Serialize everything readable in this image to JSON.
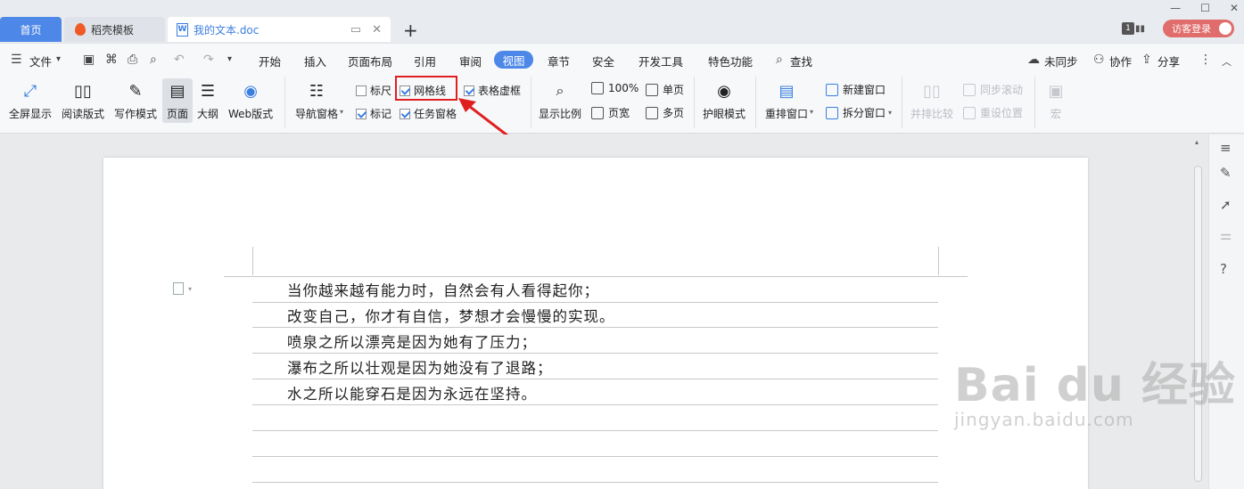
{
  "tabs": {
    "home": "首页",
    "daoke": "稻壳模板",
    "doc": "我的文本.doc"
  },
  "titlebar": {
    "badge": "1",
    "login": "访客登录"
  },
  "menu": {
    "file": "文件",
    "items": [
      "开始",
      "插入",
      "页面布局",
      "引用",
      "审阅",
      "视图",
      "章节",
      "安全",
      "开发工具",
      "特色功能"
    ],
    "active": "视图",
    "search": "查找",
    "sync": "未同步",
    "collab": "协作",
    "share": "分享"
  },
  "ribbon": {
    "fullscreen": "全屏显示",
    "reading": "阅读版式",
    "writing": "写作模式",
    "page": "页面",
    "outline": "大纲",
    "web": "Web版式",
    "nav_pane": "导航窗格",
    "ruler": "标尺",
    "gridlines": "网格线",
    "table_gridlines": "表格虚框",
    "marks": "标记",
    "task_pane": "任务窗格",
    "zoom": "显示比例",
    "zoom100": "100%",
    "single_page": "单页",
    "page_width": "页宽",
    "multi_page": "多页",
    "eye_mode": "护眼模式",
    "rearrange": "重排窗口",
    "new_window": "新建窗口",
    "split_window": "拆分窗口",
    "side_by_side": "并排比较",
    "sync_scroll": "同步滚动",
    "reset_pos": "重设位置",
    "macro": "宏"
  },
  "document": {
    "lines": [
      "当你越来越有能力时，自然会有人看得起你；",
      "改变自己，你才有自信，梦想才会慢慢的实现。",
      "喷泉之所以漂亮是因为她有了压力；",
      "瀑布之所以壮观是因为她没有了退路；",
      "水之所以能穿石是因为永远在坚持。"
    ]
  },
  "watermark": {
    "main": "Bai du 经验",
    "sub": "jingyan.baidu.com"
  },
  "colors": {
    "accent": "#4d87e8",
    "highlight": "#e02020",
    "login": "#e06c6c"
  }
}
